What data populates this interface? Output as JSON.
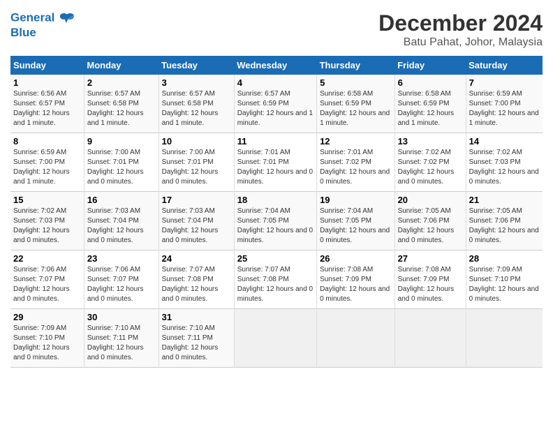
{
  "logo": {
    "line1": "General",
    "line2": "Blue"
  },
  "title": "December 2024",
  "location": "Batu Pahat, Johor, Malaysia",
  "days_of_week": [
    "Sunday",
    "Monday",
    "Tuesday",
    "Wednesday",
    "Thursday",
    "Friday",
    "Saturday"
  ],
  "weeks": [
    [
      {
        "num": "1",
        "rise": "6:56 AM",
        "set": "6:57 PM",
        "daylight": "12 hours and 1 minute."
      },
      {
        "num": "2",
        "rise": "6:57 AM",
        "set": "6:58 PM",
        "daylight": "12 hours and 1 minute."
      },
      {
        "num": "3",
        "rise": "6:57 AM",
        "set": "6:58 PM",
        "daylight": "12 hours and 1 minute."
      },
      {
        "num": "4",
        "rise": "6:57 AM",
        "set": "6:59 PM",
        "daylight": "12 hours and 1 minute."
      },
      {
        "num": "5",
        "rise": "6:58 AM",
        "set": "6:59 PM",
        "daylight": "12 hours and 1 minute."
      },
      {
        "num": "6",
        "rise": "6:58 AM",
        "set": "6:59 PM",
        "daylight": "12 hours and 1 minute."
      },
      {
        "num": "7",
        "rise": "6:59 AM",
        "set": "7:00 PM",
        "daylight": "12 hours and 1 minute."
      }
    ],
    [
      {
        "num": "8",
        "rise": "6:59 AM",
        "set": "7:00 PM",
        "daylight": "12 hours and 1 minute."
      },
      {
        "num": "9",
        "rise": "7:00 AM",
        "set": "7:01 PM",
        "daylight": "12 hours and 0 minutes."
      },
      {
        "num": "10",
        "rise": "7:00 AM",
        "set": "7:01 PM",
        "daylight": "12 hours and 0 minutes."
      },
      {
        "num": "11",
        "rise": "7:01 AM",
        "set": "7:01 PM",
        "daylight": "12 hours and 0 minutes."
      },
      {
        "num": "12",
        "rise": "7:01 AM",
        "set": "7:02 PM",
        "daylight": "12 hours and 0 minutes."
      },
      {
        "num": "13",
        "rise": "7:02 AM",
        "set": "7:02 PM",
        "daylight": "12 hours and 0 minutes."
      },
      {
        "num": "14",
        "rise": "7:02 AM",
        "set": "7:03 PM",
        "daylight": "12 hours and 0 minutes."
      }
    ],
    [
      {
        "num": "15",
        "rise": "7:02 AM",
        "set": "7:03 PM",
        "daylight": "12 hours and 0 minutes."
      },
      {
        "num": "16",
        "rise": "7:03 AM",
        "set": "7:04 PM",
        "daylight": "12 hours and 0 minutes."
      },
      {
        "num": "17",
        "rise": "7:03 AM",
        "set": "7:04 PM",
        "daylight": "12 hours and 0 minutes."
      },
      {
        "num": "18",
        "rise": "7:04 AM",
        "set": "7:05 PM",
        "daylight": "12 hours and 0 minutes."
      },
      {
        "num": "19",
        "rise": "7:04 AM",
        "set": "7:05 PM",
        "daylight": "12 hours and 0 minutes."
      },
      {
        "num": "20",
        "rise": "7:05 AM",
        "set": "7:06 PM",
        "daylight": "12 hours and 0 minutes."
      },
      {
        "num": "21",
        "rise": "7:05 AM",
        "set": "7:06 PM",
        "daylight": "12 hours and 0 minutes."
      }
    ],
    [
      {
        "num": "22",
        "rise": "7:06 AM",
        "set": "7:07 PM",
        "daylight": "12 hours and 0 minutes."
      },
      {
        "num": "23",
        "rise": "7:06 AM",
        "set": "7:07 PM",
        "daylight": "12 hours and 0 minutes."
      },
      {
        "num": "24",
        "rise": "7:07 AM",
        "set": "7:08 PM",
        "daylight": "12 hours and 0 minutes."
      },
      {
        "num": "25",
        "rise": "7:07 AM",
        "set": "7:08 PM",
        "daylight": "12 hours and 0 minutes."
      },
      {
        "num": "26",
        "rise": "7:08 AM",
        "set": "7:09 PM",
        "daylight": "12 hours and 0 minutes."
      },
      {
        "num": "27",
        "rise": "7:08 AM",
        "set": "7:09 PM",
        "daylight": "12 hours and 0 minutes."
      },
      {
        "num": "28",
        "rise": "7:09 AM",
        "set": "7:10 PM",
        "daylight": "12 hours and 0 minutes."
      }
    ],
    [
      {
        "num": "29",
        "rise": "7:09 AM",
        "set": "7:10 PM",
        "daylight": "12 hours and 0 minutes."
      },
      {
        "num": "30",
        "rise": "7:10 AM",
        "set": "7:11 PM",
        "daylight": "12 hours and 0 minutes."
      },
      {
        "num": "31",
        "rise": "7:10 AM",
        "set": "7:11 PM",
        "daylight": "12 hours and 0 minutes."
      },
      null,
      null,
      null,
      null
    ]
  ]
}
